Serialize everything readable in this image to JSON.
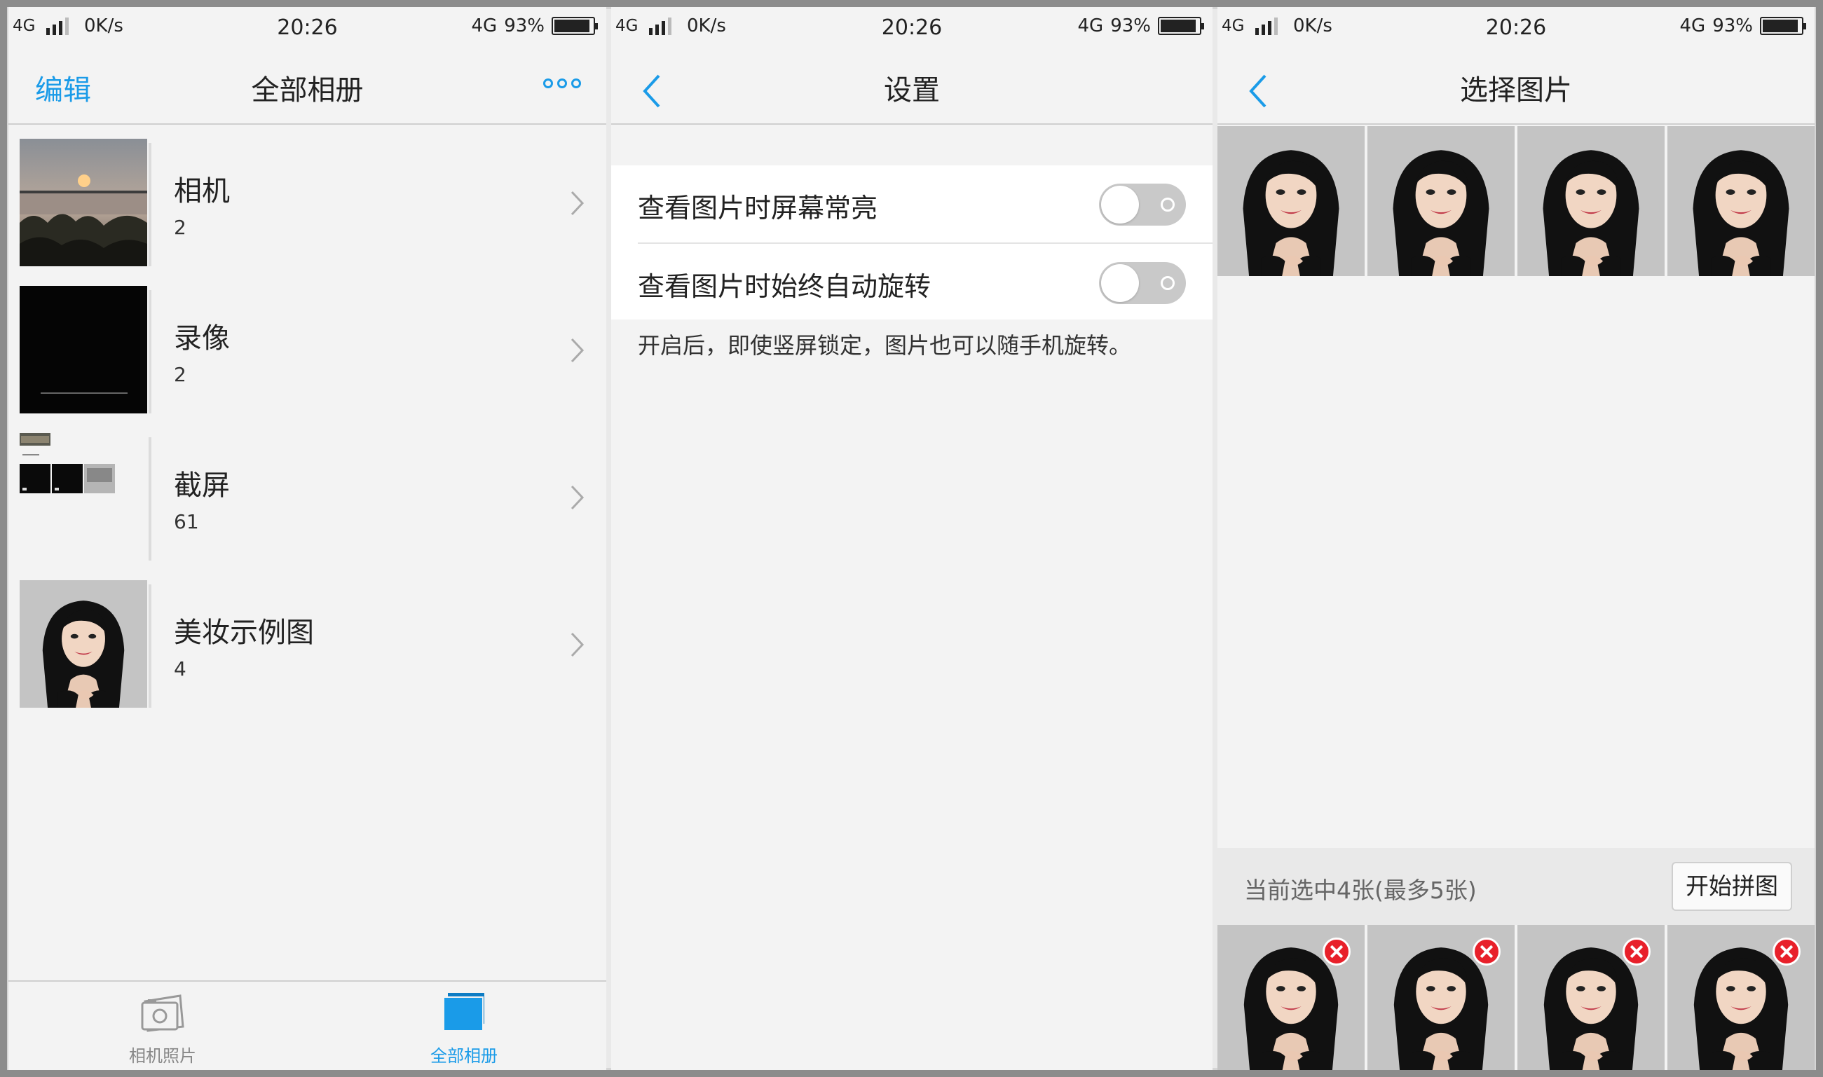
{
  "status_bar": {
    "network": "4G",
    "speed": "0K/s",
    "time": "20:26",
    "network_right": "4G",
    "battery": "93%",
    "battery_level": 0.93
  },
  "albums_screen": {
    "edit_label": "编辑",
    "title": "全部相册",
    "albums": [
      {
        "name": "相机",
        "count": "2"
      },
      {
        "name": "录像",
        "count": "2"
      },
      {
        "name": "截屏",
        "count": "61"
      },
      {
        "name": "美妆示例图",
        "count": "4"
      }
    ],
    "tabs": [
      {
        "label": "相机照片",
        "active": false
      },
      {
        "label": "全部相册",
        "active": true
      }
    ]
  },
  "settings_screen": {
    "title": "设置",
    "rows": [
      {
        "label": "查看图片时屏幕常亮",
        "enabled": false
      },
      {
        "label": "查看图片时始终自动旋转",
        "enabled": false
      }
    ],
    "hint": "开启后，即使竖屏锁定，图片也可以随手机旋转。"
  },
  "select_screen": {
    "title": "选择图片",
    "selection_info": "当前选中4张(最多5张)",
    "start_label": "开始拼图"
  },
  "colors": {
    "accent": "#1a9be8",
    "remove": "#e8202a",
    "toggle_off": "#c9c9c9"
  }
}
